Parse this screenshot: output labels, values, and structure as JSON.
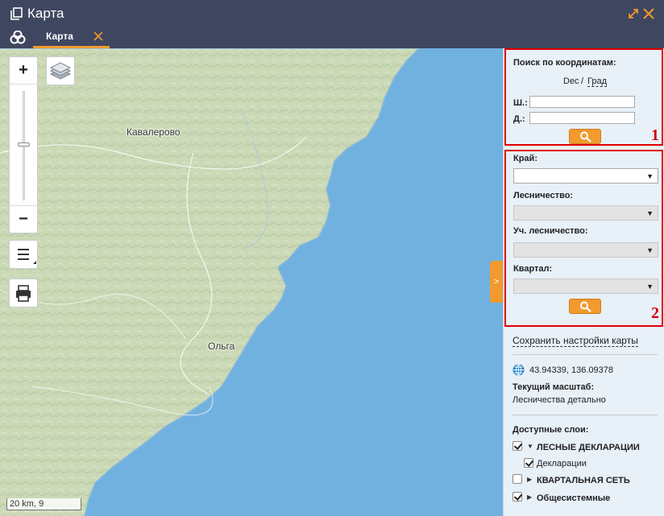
{
  "window": {
    "title": "Карта",
    "icon": "copy-window-icon"
  },
  "tabs": [
    {
      "label": "Карта",
      "active": true
    }
  ],
  "map": {
    "places": [
      {
        "name": "Кавалерово"
      },
      {
        "name": "Ольга"
      }
    ],
    "zoom": {
      "plus": "+",
      "minus": "−",
      "level_fraction": 0.51
    },
    "scale_label": "20 km, 9",
    "collapse_label": ">"
  },
  "coord_search": {
    "title": "Поиск по координатам:",
    "format_dec": "Dec",
    "format_sep": "/",
    "format_deg": "Град",
    "lat_label": "Ш.:",
    "lon_label": "Д.:",
    "lat_value": "",
    "lon_value": "",
    "annotation": "1"
  },
  "area_search": {
    "region_label": "Край:",
    "forestry_label": "Лесничество:",
    "subforestry_label": "Уч. лесничество:",
    "quarter_label": "Квартал:",
    "annotation": "2"
  },
  "panel": {
    "save_settings": "Сохранить настройки карты",
    "coordinates": "43.94339, 136.09378",
    "scale_title": "Текущий масштаб:",
    "scale_value": "Лесничества детально",
    "layers_title": "Доступные слои:",
    "layers": [
      {
        "label": "ЛЕСНЫЕ ДЕКЛАРАЦИИ",
        "checked": true,
        "level": 0
      },
      {
        "label": "Декларации",
        "checked": true,
        "level": 1
      },
      {
        "label": "КВАРТАЛЬНАЯ СЕТЬ",
        "checked": false,
        "level": 0
      },
      {
        "label": "Общесистемные",
        "checked": true,
        "level": 0
      }
    ]
  },
  "colors": {
    "header_bg": "#3f4660",
    "accent": "#f29a2e",
    "water": "#71b1e0",
    "land": "#cfdcbc",
    "panel_bg": "#e8f0f8",
    "annotation_red": "#e00000"
  }
}
